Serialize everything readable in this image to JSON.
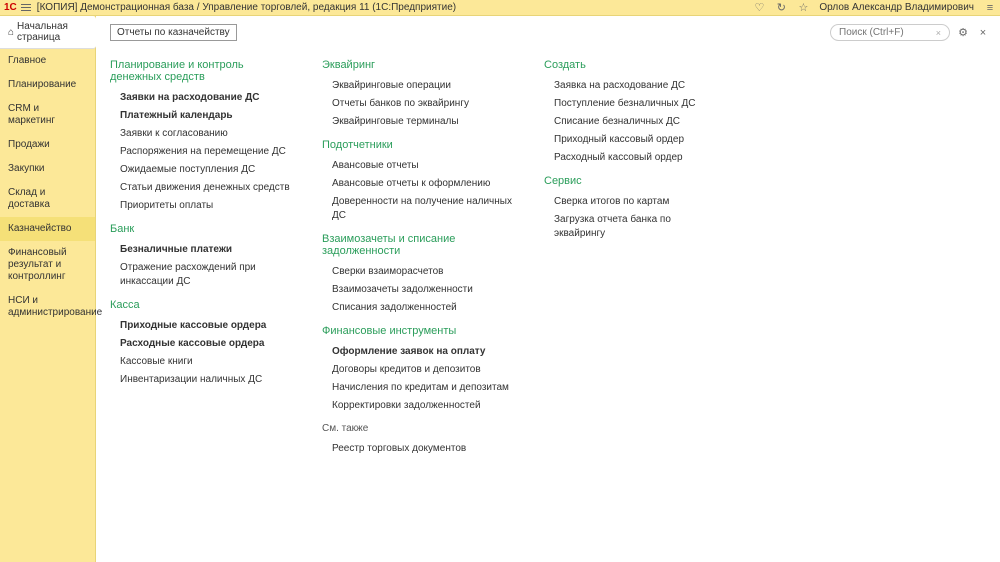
{
  "titlebar": {
    "logo": "1С",
    "title": "[КОПИЯ] Демонстрационная база / Управление торговлей, редакция 11  (1С:Предприятие)",
    "user": "Орлов Александр Владимирович"
  },
  "search": {
    "placeholder": "Поиск (Ctrl+F)"
  },
  "home": "Начальная страница",
  "nav": [
    "Главное",
    "Планирование",
    "CRM и маркетинг",
    "Продажи",
    "Закупки",
    "Склад и доставка",
    "Казначейство",
    "Финансовый результат и контроллинг",
    "НСИ и администрирование"
  ],
  "reportsBtn": "Отчеты по казначейству",
  "col1": {
    "s1": {
      "title": "Планирование и контроль денежных средств",
      "items": [
        "Заявки на расходование ДС",
        "Платежный календарь",
        "Заявки к согласованию",
        "Распоряжения на перемещение ДС",
        "Ожидаемые поступления ДС",
        "Статьи движения денежных средств",
        "Приоритеты оплаты"
      ],
      "bold": [
        0,
        1
      ]
    },
    "s2": {
      "title": "Банк",
      "items": [
        "Безналичные платежи",
        "Отражение расхождений при инкассации ДС"
      ],
      "bold": [
        0
      ]
    },
    "s3": {
      "title": "Касса",
      "items": [
        "Приходные кассовые ордера",
        "Расходные кассовые ордера",
        "Кассовые книги",
        "Инвентаризации наличных ДС"
      ],
      "bold": [
        0,
        1
      ]
    }
  },
  "col2": {
    "s1": {
      "title": "Эквайринг",
      "items": [
        "Эквайринговые операции",
        "Отчеты банков по эквайрингу",
        "Эквайринговые терминалы"
      ]
    },
    "s2": {
      "title": "Подотчетники",
      "items": [
        "Авансовые отчеты",
        "Авансовые отчеты к оформлению",
        "Доверенности на получение наличных ДС"
      ]
    },
    "s3": {
      "title": "Взаимозачеты и списание задолженности",
      "items": [
        "Сверки взаиморасчетов",
        "Взаимозачеты задолженности",
        "Списания задолженностей"
      ]
    },
    "s4": {
      "title": "Финансовые инструменты",
      "items": [
        "Оформление заявок на оплату",
        "Договоры кредитов и депозитов",
        "Начисления по кредитам и депозитам",
        "Корректировки задолженностей"
      ],
      "bold": [
        0
      ]
    },
    "s5": {
      "title": "См. также",
      "sub": true,
      "items": [
        "Реестр торговых документов"
      ]
    }
  },
  "col3": {
    "s1": {
      "title": "Создать",
      "items": [
        "Заявка на расходование ДС",
        "Поступление безналичных ДС",
        "Списание безналичных ДС",
        "Приходный кассовый ордер",
        "Расходный кассовый ордер"
      ]
    },
    "s2": {
      "title": "Сервис",
      "items": [
        "Сверка итогов по картам",
        "Загрузка отчета банка по эквайрингу"
      ]
    }
  }
}
